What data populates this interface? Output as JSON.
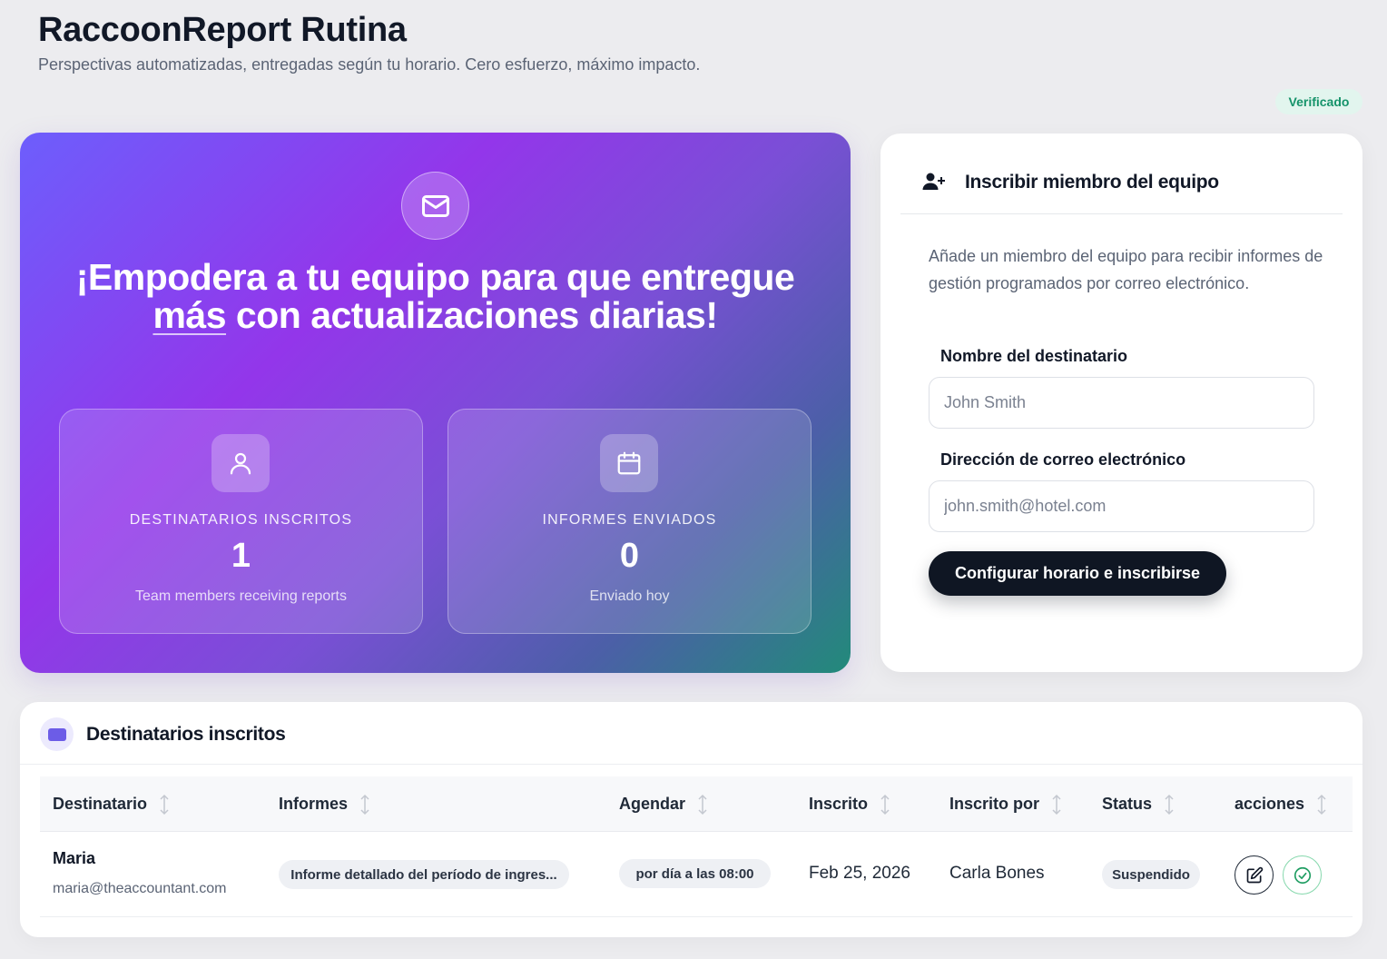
{
  "header": {
    "title": "RaccoonReport Rutina",
    "subtitle": "Perspectivas automatizadas, entregadas según tu horario. Cero esfuerzo, máximo impacto."
  },
  "verified_badge": "Verificado",
  "hero": {
    "icon": "mail-icon",
    "headline_part1": "¡Empodera a tu equipo para que entregue ",
    "headline_emphasis": "más",
    "headline_part2": " con actualizaciones diarias!",
    "stats": [
      {
        "icon": "user-icon",
        "label": "DESTINATARIOS INSCRITOS",
        "value": "1",
        "sub": "Team members receiving reports"
      },
      {
        "icon": "calendar-icon",
        "label": "INFORMES ENVIADOS",
        "value": "0",
        "sub": "Enviado hoy"
      }
    ]
  },
  "enroll": {
    "icon": "user-plus-icon",
    "title": "Inscribir miembro del equipo",
    "description": "Añade un miembro del equipo para recibir informes de gestión programados por correo electrónico.",
    "name_label": "Nombre del destinatario",
    "name_placeholder": "John Smith",
    "email_label": "Dirección de correo electrónico",
    "email_placeholder": "john.smith@hotel.com",
    "submit_label": "Configurar horario e inscribirse"
  },
  "recipients": {
    "title": "Destinatarios inscritos",
    "columns": [
      "Destinatario",
      "Informes",
      "Agendar",
      "Inscrito",
      "Inscrito por",
      "Status",
      "acciones"
    ],
    "rows": [
      {
        "name": "Maria",
        "email": "maria@theaccountant.com",
        "report": "Informe detallado del período de ingres...",
        "schedule": "por día a las 08:00",
        "enrolled": "Feb 25, 2026",
        "enrolled_by": "Carla Bones",
        "status": "Suspendido",
        "actions": [
          "edit-icon",
          "check-circle-icon"
        ]
      }
    ]
  },
  "colors": {
    "accent": "#9336ea",
    "dark_button": "#0f1623",
    "verified": "#15936a",
    "table_icon": "#6c5ce7"
  }
}
